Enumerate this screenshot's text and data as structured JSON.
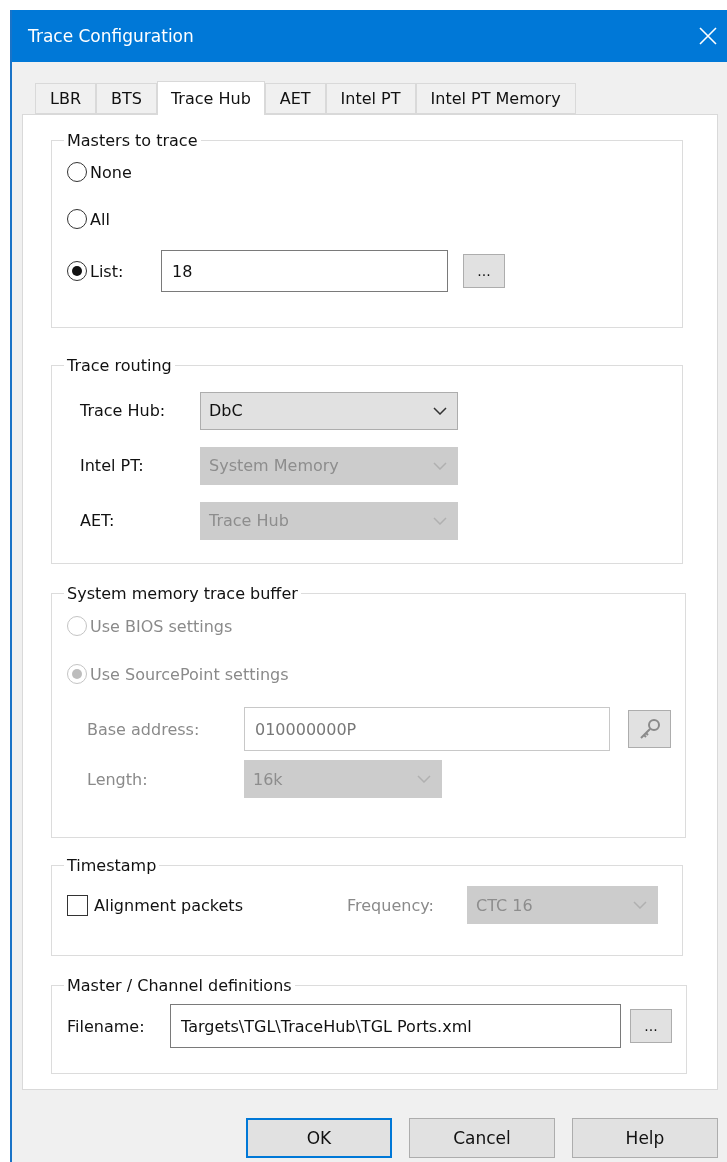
{
  "window": {
    "title": "Trace Configuration"
  },
  "tabs": [
    {
      "label": "LBR",
      "selected": false
    },
    {
      "label": "BTS",
      "selected": false
    },
    {
      "label": "Trace Hub",
      "selected": true
    },
    {
      "label": "AET",
      "selected": false
    },
    {
      "label": "Intel PT",
      "selected": false
    },
    {
      "label": "Intel PT Memory",
      "selected": false
    }
  ],
  "masters": {
    "title": "Masters to trace",
    "options": [
      {
        "label": "None",
        "selected": false
      },
      {
        "label": "All",
        "selected": false
      },
      {
        "label": "List:",
        "selected": true
      }
    ],
    "list_value": "18",
    "browse_button": "..."
  },
  "routing": {
    "title": "Trace routing",
    "rows": [
      {
        "label": "Trace Hub:",
        "value": "DbC",
        "disabled": false
      },
      {
        "label": "Intel PT:",
        "value": "System Memory",
        "disabled": true
      },
      {
        "label": "AET:",
        "value": "Trace Hub",
        "disabled": true
      }
    ]
  },
  "memory_buffer": {
    "title": "System memory trace buffer",
    "disabled": true,
    "options": [
      {
        "label": "Use BIOS settings",
        "selected": false
      },
      {
        "label": "Use SourcePoint settings",
        "selected": true
      }
    ],
    "base_address": {
      "label": "Base address:",
      "value": "010000000P"
    },
    "length": {
      "label": "Length:",
      "value": "16k"
    }
  },
  "timestamp": {
    "title": "Timestamp",
    "alignment": {
      "label": "Alignment packets",
      "checked": false
    },
    "frequency": {
      "label": "Frequency:",
      "value": "CTC 16",
      "disabled": true
    }
  },
  "definitions": {
    "title": "Master / Channel definitions",
    "filename": {
      "label": "Filename:",
      "value": "Targets\\TGL\\TraceHub\\TGL Ports.xml"
    },
    "browse_button": "..."
  },
  "buttons": [
    {
      "label": "OK",
      "default": true
    },
    {
      "label": "Cancel",
      "default": false
    },
    {
      "label": "Help",
      "default": false
    }
  ]
}
